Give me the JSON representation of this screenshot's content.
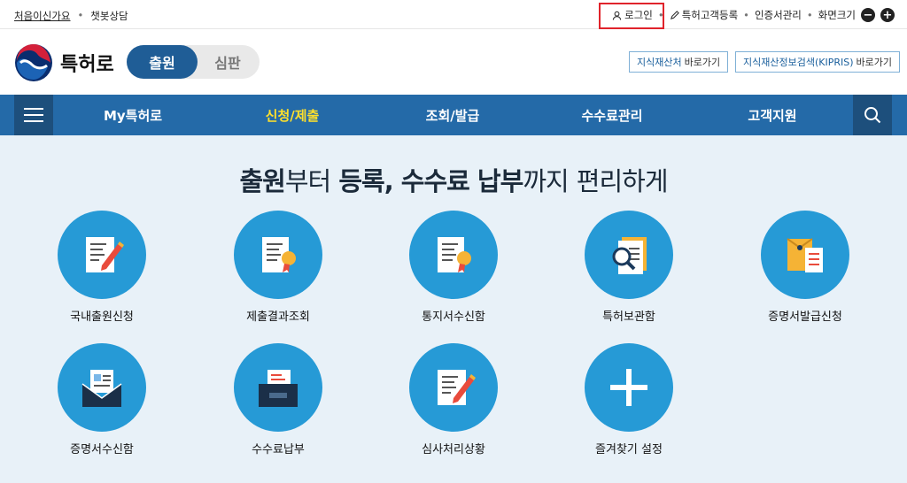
{
  "topbar": {
    "first_visit": "처음이신가요",
    "chat": "챗봇상담",
    "login": "로그인",
    "register": "특허고객등록",
    "cert": "인증서관리",
    "zoom": "화면크기",
    "zoom_out": "−",
    "zoom_in": "+"
  },
  "header": {
    "logo_text": "특허로",
    "toggle_on": "출원",
    "toggle_off": "심판",
    "quick1": {
      "text": "지식재산처",
      "suffix": "바로가기"
    },
    "quick2": {
      "text": "지식재산정보검색(KIPRIS)",
      "suffix": "바로가기"
    }
  },
  "nav": {
    "items": [
      "My특허로",
      "신청/제출",
      "조회/발급",
      "수수료관리",
      "고객지원"
    ],
    "active": "신청/제출"
  },
  "hero": {
    "part1": "출원",
    "part2": "부터",
    "part3": "등록, 수수료 납부",
    "part4": "까지",
    "part5": "편리하게"
  },
  "tiles": [
    {
      "label": "국내출원신청",
      "icon": "document-pencil-icon"
    },
    {
      "label": "제출결과조회",
      "icon": "certificate-document-icon"
    },
    {
      "label": "통지서수신함",
      "icon": "certificate-document-icon"
    },
    {
      "label": "특허보관함",
      "icon": "magnifier-document-icon"
    },
    {
      "label": "증명서발급신청",
      "icon": "envelope-document-icon"
    },
    {
      "label": "증명서수신함",
      "icon": "open-mail-icon"
    },
    {
      "label": "수수료납부",
      "icon": "folder-icon"
    },
    {
      "label": "심사처리상황",
      "icon": "document-pencil-icon"
    },
    {
      "label": "즐겨찾기 설정",
      "icon": "plus-icon"
    }
  ],
  "colors": {
    "primary": "#246aa8",
    "accent": "#ffe02b",
    "tile": "#269ad6",
    "highlight": "#e0232b"
  }
}
